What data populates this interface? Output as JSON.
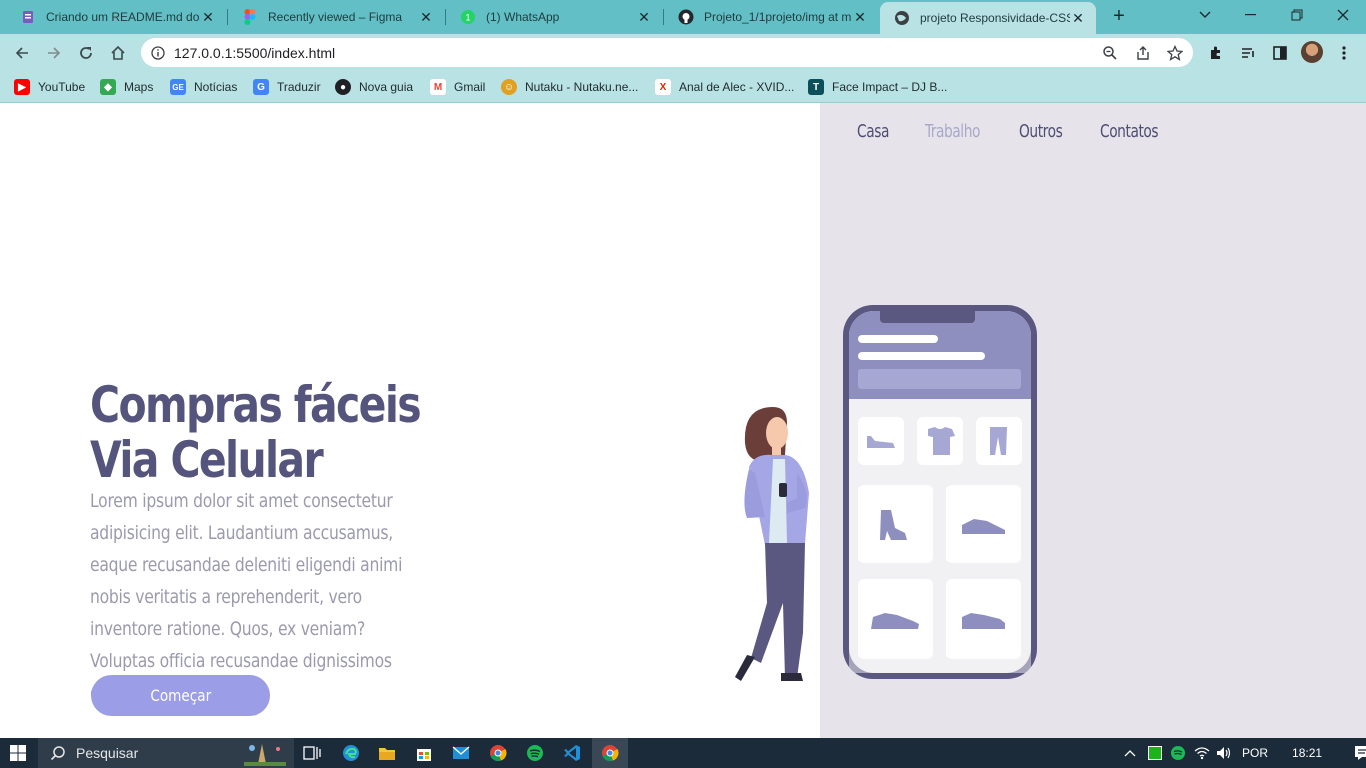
{
  "browser": {
    "tabs": [
      {
        "title": "Criando um README.md dos",
        "icon": "document-icon",
        "color": "#7a5cc0"
      },
      {
        "title": "Recently viewed – Figma",
        "icon": "figma-icon",
        "color": "#f24e1e"
      },
      {
        "title": "(1) WhatsApp",
        "icon": "whatsapp-icon",
        "color": "#25d366"
      },
      {
        "title": "Projeto_1/1projeto/img at m",
        "icon": "github-icon",
        "color": "#24292f"
      },
      {
        "title": "projeto Responsividade-CSS",
        "icon": "globe-icon",
        "color": "#3c4043",
        "active": true
      }
    ],
    "url": "127.0.0.1:5500/index.html",
    "bookmarks": [
      {
        "label": "YouTube",
        "icon": "youtube-icon",
        "color": "#ff0000"
      },
      {
        "label": "Maps",
        "icon": "maps-icon",
        "color": "#34a853"
      },
      {
        "label": "Notícias",
        "icon": "news-icon",
        "color": "#4285f4"
      },
      {
        "label": "Traduzir",
        "icon": "translate-icon",
        "color": "#4285f4"
      },
      {
        "label": "Nova guia",
        "icon": "globe-icon",
        "color": "#202124"
      },
      {
        "label": "Gmail",
        "icon": "gmail-icon",
        "color": "#ea4335"
      },
      {
        "label": "Nutaku - Nutaku.ne...",
        "icon": "nutaku-icon",
        "color": "#e0a020"
      },
      {
        "label": "Anal de Alec - XVID...",
        "icon": "xvideos-icon",
        "color": "#de2600"
      },
      {
        "label": "Face Impact – DJ B...",
        "icon": "t-icon",
        "color": "#0b4f5a"
      }
    ]
  },
  "site": {
    "nav": [
      "Casa",
      "Trabalho",
      "Outros",
      "Contatos"
    ],
    "title": "Compras fáceis Via Celular",
    "description": "Lorem ipsum dolor sit amet consectetur adipisicing elit. Laudantium accusamus, eaque recusandae deleniti eligendi animi nobis veritatis a reprehenderit, vero inventore ratione. Quos, ex veniam? Voluptas officia recusandae dignissimos quod!.",
    "cta": "Começar",
    "colors": {
      "primary": "#55547c",
      "accent": "#9b9de6",
      "panel": "#e6e4ea",
      "muted": "#9b9aad"
    }
  },
  "taskbar": {
    "search_placeholder": "Pesquisar",
    "language": "POR",
    "time": "18:21"
  }
}
